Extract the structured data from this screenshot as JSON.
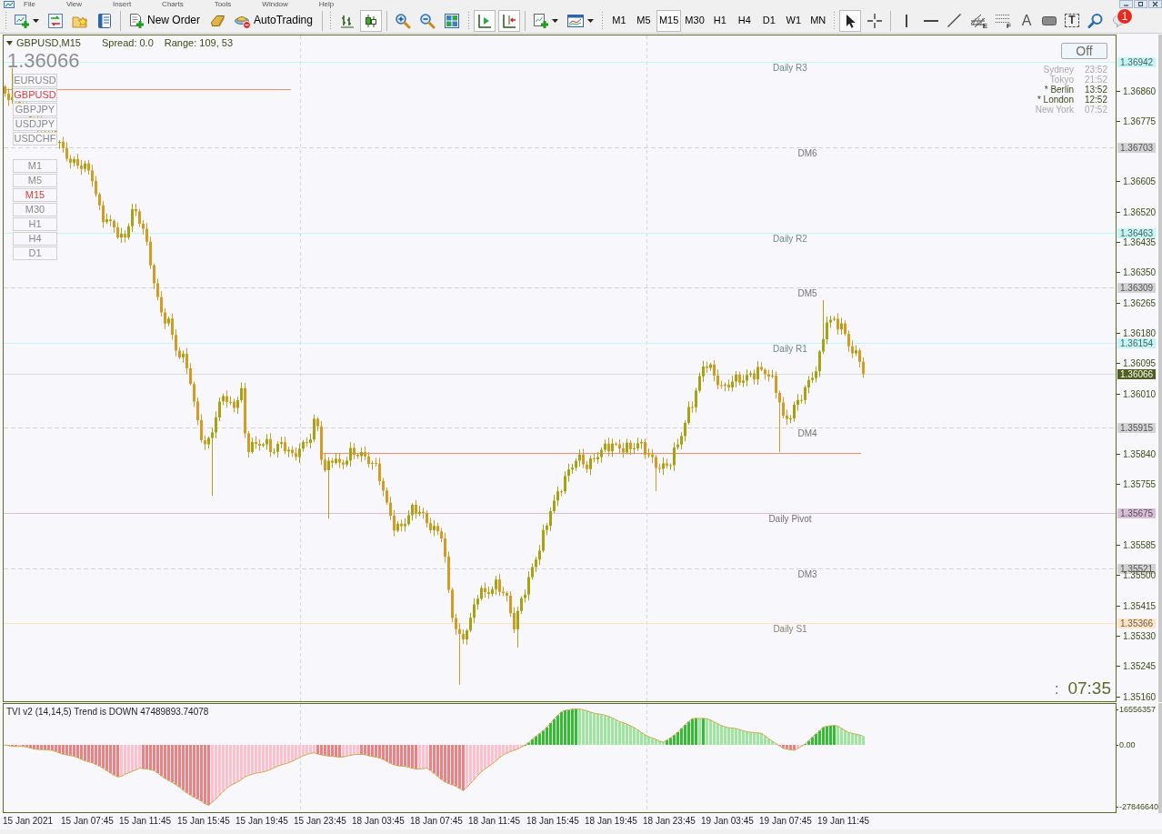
{
  "menu_bar": [
    "File",
    "View",
    "Insert",
    "Charts",
    "Tools",
    "Window",
    "Help"
  ],
  "toolbar": {
    "new_order": "New Order",
    "autotrading": "AutoTrading",
    "chart_types": [
      {
        "selected": false
      },
      {
        "selected": true
      }
    ],
    "chart_modes": [
      {
        "selected": true
      },
      {
        "selected": true
      }
    ],
    "timeframes": [
      {
        "label": "M1",
        "selected": false
      },
      {
        "label": "M5",
        "selected": false
      },
      {
        "label": "M15",
        "selected": true
      },
      {
        "label": "M30",
        "selected": false
      },
      {
        "label": "H1",
        "selected": false
      },
      {
        "label": "H4",
        "selected": false
      },
      {
        "label": "D1",
        "selected": false
      },
      {
        "label": "W1",
        "selected": false
      },
      {
        "label": "MN",
        "selected": false
      }
    ],
    "pointers": [
      {
        "selected": true
      },
      {
        "selected": false
      }
    ],
    "channel_mark": "E",
    "fibo_mark": "F",
    "text_tool": "A",
    "text_label_tool": "T",
    "alerts_badge": "1"
  },
  "chart": {
    "symbol": "GBPUSD,M15",
    "spread": "Spread: 0.0",
    "range": "Range: 109, 53",
    "bid": "1.36066",
    "symbol_buttons": [
      {
        "label": "EURUSD",
        "selected": false
      },
      {
        "label": "GBPUSD",
        "selected": true
      },
      {
        "label": "GBPJPY",
        "selected": false
      },
      {
        "label": "USDJPY",
        "selected": false
      },
      {
        "label": "USDCHF",
        "selected": false
      }
    ],
    "period_buttons": [
      {
        "label": "M1",
        "selected": false
      },
      {
        "label": "M5",
        "selected": false
      },
      {
        "label": "M15",
        "selected": true
      },
      {
        "label": "M30",
        "selected": false
      },
      {
        "label": "H1",
        "selected": false
      },
      {
        "label": "H4",
        "selected": false
      },
      {
        "label": "D1",
        "selected": false
      }
    ],
    "sessions_button": "Off",
    "sessions": [
      {
        "name": "Sydney",
        "time": "23:52",
        "active": false
      },
      {
        "name": "Tokyo",
        "time": "21:52",
        "active": false
      },
      {
        "name": "* Berlin",
        "time": "13:52",
        "active": true
      },
      {
        "name": "* London",
        "time": "12:52",
        "active": true
      },
      {
        "name": "New York",
        "time": "07:52",
        "active": false
      }
    ],
    "levels": [
      {
        "kind": "pivot",
        "label": "Daily R3",
        "price": "1.36942",
        "color": "#c4f5f5"
      },
      {
        "kind": "dm",
        "label": "DM6",
        "price": "1.36703",
        "color": "#d3d3d3"
      },
      {
        "kind": "pivot",
        "label": "Daily R2",
        "price": "1.36463",
        "color": "#c4f5f5"
      },
      {
        "kind": "dm",
        "label": "DM5",
        "price": "1.36309",
        "color": "#d3d3d3"
      },
      {
        "kind": "pivot",
        "label": "Daily R1",
        "price": "1.36154",
        "color": "#c4f5f5"
      },
      {
        "kind": "dm",
        "label": "DM4",
        "price": "1.35915",
        "color": "#d3d3d3"
      },
      {
        "kind": "pivot",
        "label": "Daily Pivot",
        "price": "1.35675",
        "color": "#d8bfd8"
      },
      {
        "kind": "dm",
        "label": "DM3",
        "price": "1.35521",
        "color": "#d3d3d3"
      },
      {
        "kind": "pivot",
        "label": "Daily S1",
        "price": "1.35366",
        "color": "#ffe4c4"
      }
    ],
    "current_price": "1.36066",
    "price_ticks": [
      "1.36860",
      "1.36775",
      "1.36605",
      "1.36520",
      "1.36435",
      "1.36350",
      "1.36265",
      "1.36180",
      "1.36095",
      "1.36010",
      "1.35840",
      "1.35755",
      "1.35585",
      "1.35500",
      "1.35415",
      "1.35330",
      "1.35245",
      "1.35160"
    ],
    "countdown": {
      "separator": ":",
      "time": "07:35"
    }
  },
  "indicator": {
    "title": "TVI v2 (14,14,5) Trend is DOWN 47489893.74078",
    "ticks": [
      "16556357",
      "0.00",
      "-27846640"
    ]
  },
  "time_axis": [
    "15 Jan 2021",
    "15 Jan 07:45",
    "15 Jan 11:45",
    "15 Jan 15:45",
    "15 Jan 19:45",
    "15 Jan 23:45",
    "18 Jan 03:45",
    "18 Jan 07:45",
    "18 Jan 11:45",
    "18 Jan 15:45",
    "18 Jan 19:45",
    "18 Jan 23:45",
    "19 Jan 03:45",
    "19 Jan 07:45",
    "19 Jan 11:45"
  ]
}
